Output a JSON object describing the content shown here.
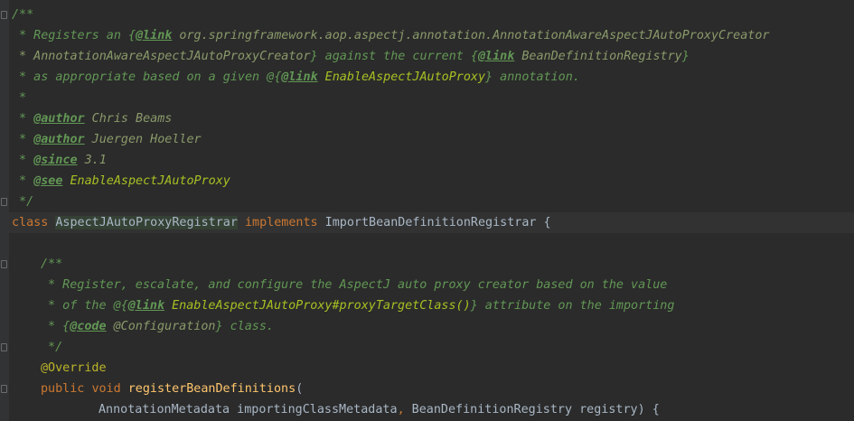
{
  "code": {
    "c1": "/**",
    "c2_pre": " * Registers an {",
    "c2_tag": "@link",
    "c2_ref": " org.springframework.aop.aspectj.annotation.AnnotationAwareAspectJAutoProxyCreator",
    "c3_ref": " * AnnotationAwareAspectJAutoProxyCreator",
    "c3_mid": "} against the current {",
    "c3_tag": "@link",
    "c3_ref2": " BeanDefinitionRegistry",
    "c3_end": "}",
    "c4_pre": " * as appropriate based on a given @{",
    "c4_tag": "@link",
    "c4_ref": " EnableAspectJAutoProxy",
    "c4_end": "} annotation.",
    "c5": " *",
    "c6_pre": " * ",
    "c6_tag": "@author",
    "c6_val": " Chris Beams",
    "c7_pre": " * ",
    "c7_tag": "@author",
    "c7_val": " Juergen Hoeller",
    "c8_pre": " * ",
    "c8_tag": "@since",
    "c8_val": " 3.1",
    "c9_pre": " * ",
    "c9_tag": "@see",
    "c9_val": " EnableAspectJAutoProxy",
    "c10": " */",
    "class_kw": "class",
    "class_name": "AspectJAutoProxyRegistrar",
    "impl_kw": "implements",
    "iface": "ImportBeanDefinitionRegistrar",
    "brace": " {",
    "m1": "/**",
    "m2": " * Register, escalate, and configure the AspectJ auto proxy creator based on the value",
    "m3_pre": " * of the @{",
    "m3_tag": "@link",
    "m3_ref": " EnableAspectJAutoProxy#proxyTargetClass()",
    "m3_end": "} attribute on the importing",
    "m4_pre": " * {",
    "m4_tag": "@code",
    "m4_ref": " @Configuration",
    "m4_end": "} class.",
    "m5": " */",
    "override": "@Override",
    "public_kw": "public",
    "void_kw": "void",
    "method": "registerBeanDefinitions",
    "paren": "(",
    "param1_type": "AnnotationMetadata",
    "param1_name": " importingClassMetadata",
    "comma": ",",
    "param2_type": " BeanDefinitionRegistry",
    "param2_name": " registry",
    "close": ") {"
  }
}
